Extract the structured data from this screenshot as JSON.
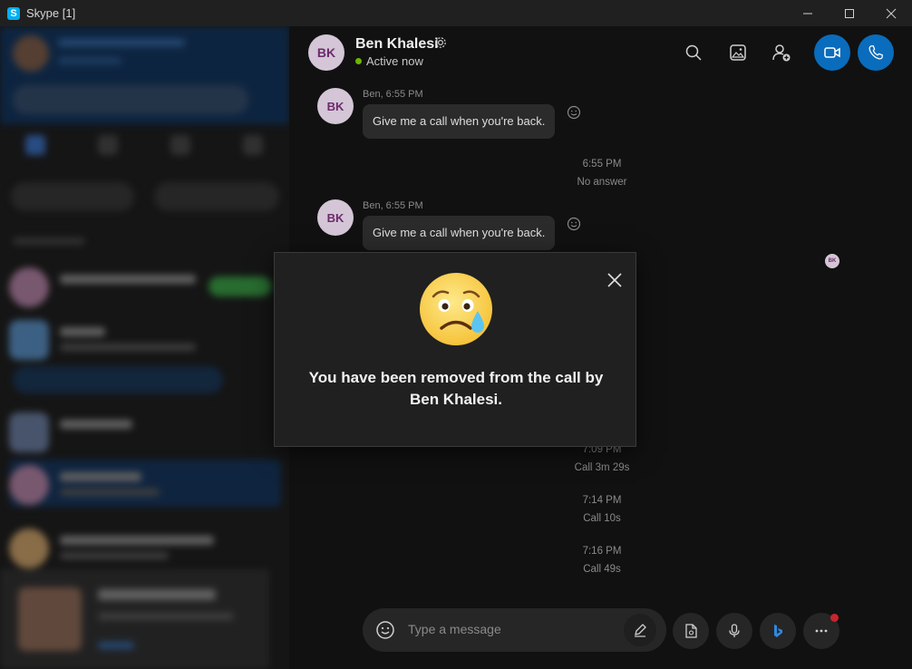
{
  "window": {
    "title": "Skype [1]",
    "logo_letter": "S"
  },
  "header": {
    "contact_initials": "BK",
    "contact_name": "Ben Khalesi",
    "status": "Active now",
    "status_color": "#6bb700",
    "accent": "#0a6cbc"
  },
  "messages": [
    {
      "initials": "BK",
      "meta": "Ben, 6:55 PM",
      "text": "Give me a call when you're back."
    },
    {
      "initials": "BK",
      "meta": "Ben, 6:55 PM",
      "text": "Give me a call when you're back."
    }
  ],
  "calls": [
    {
      "time": "6:55 PM",
      "info": "No answer"
    },
    {
      "time": "7:09 PM",
      "info": "Call 3m 29s"
    },
    {
      "time": "7:14 PM",
      "info": "Call 10s"
    },
    {
      "time": "7:16 PM",
      "info": "Call 49s"
    }
  ],
  "read_receipt_initials": "BK",
  "composer": {
    "placeholder": "Type a message"
  },
  "dialog": {
    "message": "You have been removed from the call by Ben Khalesi.",
    "emoji": "sad-tear-emoji"
  },
  "icons": {
    "header": [
      "search-icon",
      "gallery-icon",
      "add-people-icon",
      "video-call-icon",
      "audio-call-icon"
    ],
    "composer": [
      "emoji-icon",
      "pen-icon",
      "file-icon",
      "mic-icon",
      "bing-icon",
      "more-icon"
    ]
  }
}
